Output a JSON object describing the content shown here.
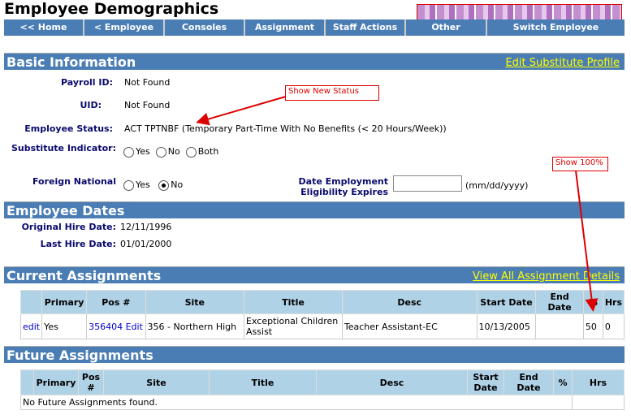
{
  "title": "Employee Demographics",
  "nav": [
    "<< Home",
    "< Employee",
    "Consoles",
    "Assignment",
    "Staff Actions",
    "Other",
    "Switch Employee"
  ],
  "basic": {
    "header": "Basic Information",
    "edit_link": "Edit Substitute Profile",
    "payroll_label": "Payroll ID:",
    "payroll_value": "Not Found",
    "uid_label": "UID:",
    "uid_value": "Not Found",
    "status_label": "Employee Status:",
    "status_value": "ACT TPTNBF (Temporary Part-Time With No Benefits (< 20 Hours/Week))",
    "sub_label": "Substitute Indicator:",
    "sub_options": [
      "Yes",
      "No",
      "Both"
    ],
    "foreign_label": "Foreign National",
    "foreign_options": [
      "Yes",
      "No"
    ],
    "foreign_selected": "No",
    "eligibility_label_1": "Date Employment",
    "eligibility_label_2": "Eligibility Expires",
    "eligibility_value": "",
    "eligibility_hint": "(mm/dd/yyyy)"
  },
  "dates": {
    "header": "Employee Dates",
    "orig_label": "Original Hire Date:",
    "orig_value": "12/11/1996",
    "last_label": "Last Hire Date:",
    "last_value": "01/01/2000"
  },
  "current": {
    "header": "Current Assignments",
    "link": "View All Assignment Details",
    "columns": [
      "",
      "Primary",
      "Pos #",
      "Site",
      "Title",
      "Desc",
      "Start Date",
      "End Date",
      "%",
      "Hrs"
    ],
    "row": {
      "edit": "edit",
      "primary": "Yes",
      "pos": "356404 Edit",
      "site": "356 - Northern High",
      "title": "Exceptional Children Assist",
      "desc": "Teacher Assistant-EC",
      "start": "10/13/2005",
      "end": "",
      "pct": "50",
      "hrs": "0"
    }
  },
  "future": {
    "header": "Future Assignments",
    "columns": [
      "",
      "Primary",
      "Pos #",
      "Site",
      "Title",
      "Desc",
      "Start Date",
      "End Date",
      "%",
      "Hrs"
    ],
    "empty": "No Future Assignments found."
  },
  "annotations": {
    "status_note": "Show New Status",
    "pct_note": "Show 100%",
    "color": "#dd0000"
  }
}
